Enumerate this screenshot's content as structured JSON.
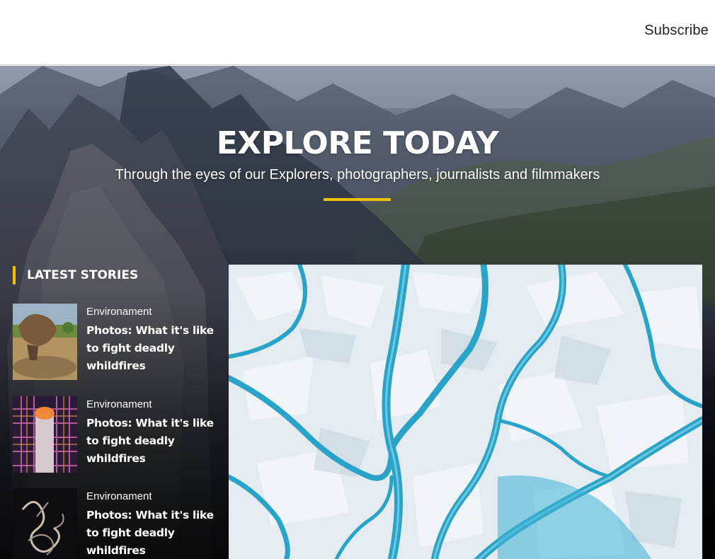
{
  "header": {
    "subscribe_label": "Subscribe"
  },
  "hero": {
    "title": "EXPLORE TODAY",
    "subtitle": "Through the eyes of our Explorers, photographers, journalists and filmmakers",
    "accent_color": "#f3c300"
  },
  "latest": {
    "heading": "LATEST STORIES",
    "stories": [
      {
        "category": "Environament",
        "title": "Photos: What it's like to fight deadly whildfires",
        "thumb": "stump-on-beach-photo"
      },
      {
        "category": "Environament",
        "title": "Photos: What it's like to fight deadly whildfires",
        "thumb": "glowing-cylinder-grid-photo"
      },
      {
        "category": "Environament",
        "title": "Photos: What it's like to fight deadly whildfires",
        "thumb": "dark-twisted-sculpture-photo"
      }
    ]
  },
  "feature": {
    "image": "aerial-glacier-meltwater-photo"
  }
}
